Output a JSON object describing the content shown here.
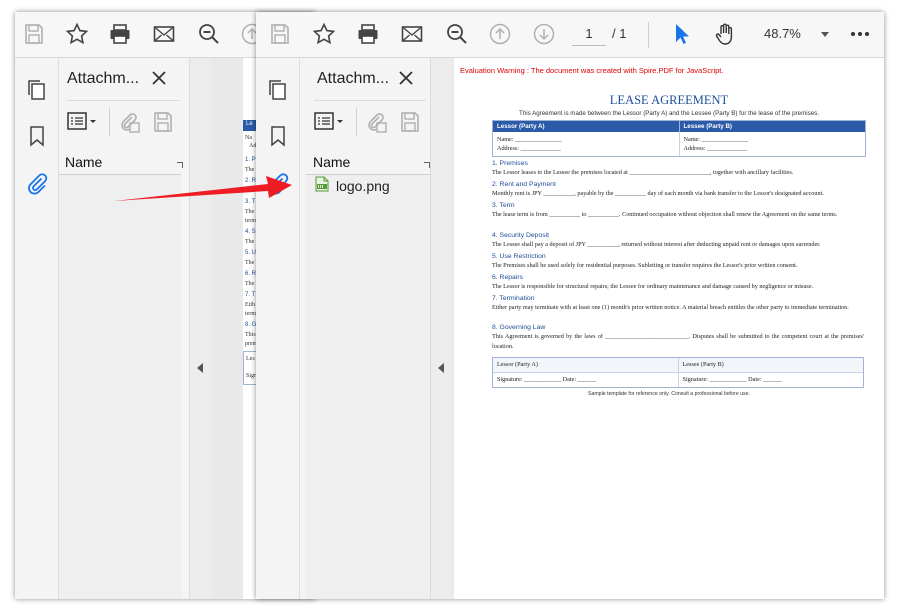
{
  "toolbar": {
    "page_current": "1",
    "page_total": "/ 1",
    "zoom": "48.7%"
  },
  "icons": [
    "save-icon",
    "star-icon",
    "print-icon",
    "mail-icon",
    "zoom-out-icon",
    "page-up-icon",
    "page-down-icon",
    "select-cursor-icon",
    "hand-icon",
    "more-icon",
    "copy-pages-icon",
    "bookmark-icon",
    "paperclip-icon",
    "list-icon",
    "attach-add-icon",
    "save-attachment-icon",
    "close-icon",
    "image-file-icon"
  ],
  "back_panel": {
    "title": "Attachm...",
    "name_header": "Name"
  },
  "front_panel": {
    "title": "Attachm...",
    "name_header": "Name",
    "items": [
      {
        "label": "logo.png"
      }
    ]
  },
  "document": {
    "warning": "Evaluation Warning : The document was created with Spire.PDF for JavaScript.",
    "title": "LEASE AGREEMENT",
    "intro": "This Agreement is made between the Lessor (Party A) and the Lessee (Party B) for the lease of the premises.",
    "party_table": {
      "headers": [
        "Lessor (Party A)",
        "Lessee (Party B)"
      ],
      "name_line": "Name: _______________",
      "address_line": "Address: _____________"
    },
    "sections": [
      {
        "heading": "1. Premises",
        "body": "The Lessor leases to the Lessee the premises located at __________________________, together with ancillary facilities."
      },
      {
        "heading": "2. Rent and Payment",
        "body": "Monthly rent is JPY __________, payable by the __________ day of each month via bank transfer to the Lessor's designated account."
      },
      {
        "heading": "3. Term",
        "body": "The lease term is from __________ to __________. Continued occupation without objection shall renew the Agreement on the same terms."
      },
      {
        "heading": "4. Security Deposit",
        "body": "The Lessee shall pay a deposit of JPY __________, returned without interest after deducting unpaid rent or damages upon surrender."
      },
      {
        "heading": "5. Use Restriction",
        "body": "The Premises shall be used solely for residential purposes. Subletting or transfer requires the Lessor's prior written consent."
      },
      {
        "heading": "6. Repairs",
        "body": "The Lessor is responsible for structural repairs; the Lessee for ordinary maintenance and damage caused by negligence or misuse."
      },
      {
        "heading": "7. Termination",
        "body": "Either party may terminate with at least one (1) month's prior written notice. A material breach entitles the other party to immediate termination."
      },
      {
        "heading": "8. Governing Law",
        "body": "This Agreement is governed by the laws of ___________________________. Disputes shall be submitted to the competent court at the premises' location."
      }
    ],
    "signature_table": {
      "parties": [
        "Lessor (Party A)",
        "Lessee (Party B)"
      ],
      "signature_line": "Signature: ____________ Date: ______"
    },
    "footer": "Sample template for reference only. Consult a professional before use."
  },
  "back_document": {
    "fragments": [
      "Le",
      "Na",
      "Ad",
      "1. P",
      "The",
      "2. R",
      "Mo",
      "3. T",
      "The",
      "term",
      "4. S",
      "The",
      "5. U",
      "The",
      "6. R",
      "The",
      "7. T",
      "Eith",
      "term",
      "8. G",
      "This",
      "prem",
      "Les",
      "Sign"
    ]
  },
  "colors": {
    "accent_blue": "#1f4e99",
    "header_blue": "#2a5aa8",
    "warning_red": "#e00000",
    "arrow_red": "#ee1c24",
    "select_blue": "#1a73e8"
  }
}
